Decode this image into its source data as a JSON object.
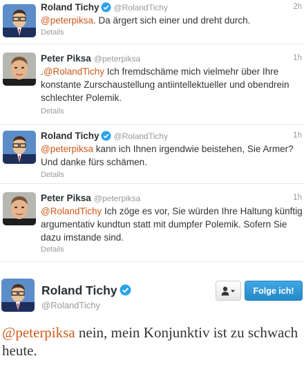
{
  "tweets": [
    {
      "id": "t1",
      "name": "Roland Tichy",
      "verified": true,
      "handle": "@RolandTichy",
      "time": "2h",
      "mention": "@peterpiksa",
      "text": ". Da ärgert sich einer und dreht durch.",
      "details": "Details"
    },
    {
      "id": "t2",
      "name": "Peter Piksa",
      "verified": false,
      "handle": "@peterpiksa",
      "time": "1h",
      "prefix": ".",
      "mention": "@RolandTichy",
      "text": " Ich fremdschäme mich vielmehr über Ihre konstante Zurschaustellung antiintellektueller und obendrein schlechter Polemik.",
      "details": "Details"
    },
    {
      "id": "t3",
      "name": "Roland Tichy",
      "verified": true,
      "handle": "@RolandTichy",
      "time": "1h",
      "mention": "@peterpiksa",
      "text": " kann ich Ihnen irgendwie beistehen, Sie Armer? Und danke fürs schämen.",
      "details": "Details"
    },
    {
      "id": "t4",
      "name": "Peter Piksa",
      "verified": false,
      "handle": "@peterpiksa",
      "time": "1h",
      "mention": "@RolandTichy",
      "text": " Ich zöge es vor, Sie würden Ihre Haltung künftig argumentativ kundtun statt mit dumpfer Polemik. Sofern Sie dazu imstande sind.",
      "details": "Details"
    }
  ],
  "focus": {
    "name": "Roland Tichy",
    "handle": "@RolandTichy",
    "user_button_icon": "user-dropdown-icon",
    "follow_label": "Folge ich!",
    "mention": "@peterpiksa",
    "text": " nein, mein Konjunktiv ist zu schwach heute."
  },
  "colors": {
    "mention": "#d0581a",
    "follow_button": "#2a8fd6",
    "verified_badge": "#2aa3ef"
  }
}
